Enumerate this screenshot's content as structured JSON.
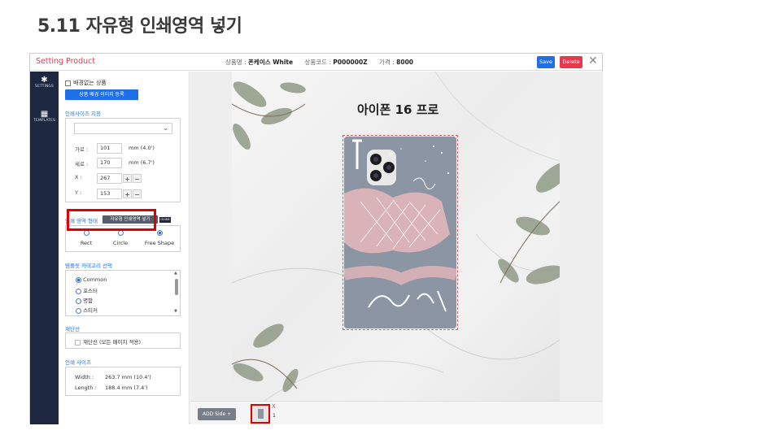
{
  "slide": {
    "title": "5.11 자유형 인쇄영역 넣기"
  },
  "header": {
    "app_title": "Setting Product",
    "product_name_label": "상품명 :",
    "product_name": "폰케이스 White",
    "product_code_label": "상품코드 :",
    "product_code": "P000000Z",
    "price_label": "가격 :",
    "price": "8000",
    "save_label": "Save",
    "delete_label": "Delete",
    "close_glyph": "✕"
  },
  "iconbar": {
    "items": [
      {
        "label": "SETTINGS",
        "icon": "gear-icon",
        "glyph": "✱"
      },
      {
        "label": "TEMPLATES",
        "icon": "templates-icon",
        "glyph": "▦"
      }
    ]
  },
  "panel": {
    "no_bg_label": "배경없는 상품",
    "bg_image_btn": "상품 배경 이미지 등록",
    "print_size_title": "인쇄사이즈 지정",
    "width_label": "가로 :",
    "width_value": "101",
    "width_unit": "mm (4.0')",
    "height_label": "세로 :",
    "height_value": "170",
    "height_unit": "mm (6.7')",
    "x_label": "X :",
    "x_value": "267",
    "y_label": "Y :",
    "y_value": "153",
    "plus": "+",
    "minus": "−",
    "area_shape_title": "인쇄 영역 형태",
    "freeform_btn": "자유형 인쇄영역 넣기",
    "guide_badge": "GUIDE",
    "shapes": [
      {
        "label": "Rect",
        "selected": false
      },
      {
        "label": "Circle",
        "selected": false
      },
      {
        "label": "Free Shape",
        "selected": true
      }
    ],
    "template_category_title": "템플릿 카테고리 선택",
    "categories": [
      {
        "label": "Common",
        "selected": true
      },
      {
        "label": "포스터",
        "selected": false
      },
      {
        "label": "명함",
        "selected": false
      },
      {
        "label": "스티커",
        "selected": false
      }
    ],
    "cut_line_title": "재단선",
    "cut_line_option": "재단선 (모든 페이지 적용)",
    "print_size_info_title": "인쇄 사이즈",
    "info_width_label": "Width :",
    "info_width_value": "263.7 mm (10.4')",
    "info_length_label": "Length :",
    "info_length_value": "188.4 mm (7.4')"
  },
  "canvas": {
    "product_title": "아이폰 16 프로"
  },
  "bottom": {
    "add_side_label": "ADD Side +",
    "thumb_close": "X",
    "thumb_index": "1"
  },
  "colors": {
    "brand_red": "#e8384f",
    "brand_blue": "#1e6fe8",
    "sidebar": "#1d2740",
    "highlight": "#e00000"
  }
}
